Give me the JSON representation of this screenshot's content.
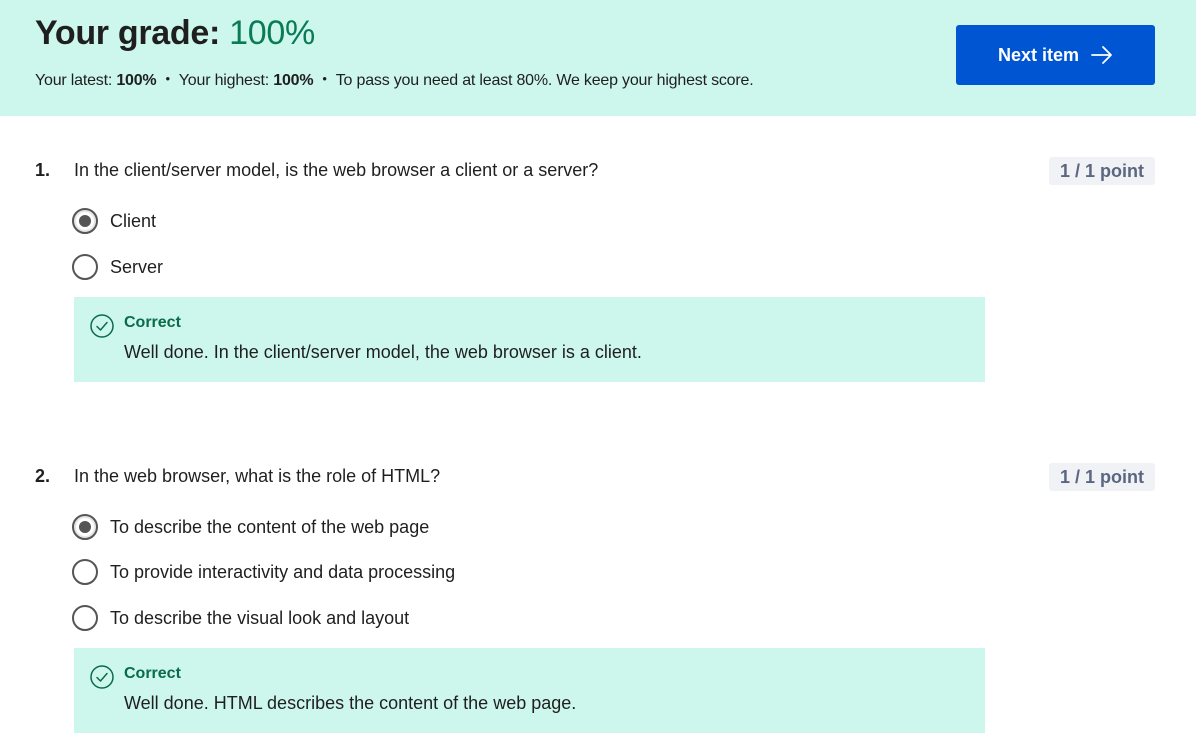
{
  "header": {
    "grade_label": "Your grade: ",
    "grade_value": "100%",
    "latest_label": "Your latest: ",
    "latest_value": "100%",
    "highest_label": "Your highest: ",
    "highest_value": "100%",
    "separator": "•",
    "pass_text": "To pass you need at least 80%. We keep your highest score.",
    "next_button_label": "Next item",
    "next_button_icon": "arrow-right-icon"
  },
  "questions": [
    {
      "number": "1.",
      "text": "In the client/server model, is the web browser a client or a server?",
      "points": "1 / 1 point",
      "options": [
        {
          "label": "Client",
          "selected": true
        },
        {
          "label": "Server",
          "selected": false
        }
      ],
      "feedback": {
        "status": "Correct",
        "icon": "check-circle-icon",
        "text": "Well done. In the client/server model, the web browser is a client."
      }
    },
    {
      "number": "2.",
      "text": "In the web browser, what is the role of HTML?",
      "points": "1 / 1 point",
      "options": [
        {
          "label": "To describe the content of the web page",
          "selected": true
        },
        {
          "label": "To provide interactivity and data processing",
          "selected": false
        },
        {
          "label": "To describe the visual look and layout",
          "selected": false
        }
      ],
      "feedback": {
        "status": "Correct",
        "icon": "check-circle-icon",
        "text": "Well done. HTML describes the content of the web page."
      }
    }
  ],
  "colors": {
    "banner_bg": "#cdf7ec",
    "grade_green": "#0a7b55",
    "primary_button": "#0056d2",
    "points_bg": "#f0f2f6",
    "feedback_bg": "#cdf7ec",
    "correct_green": "#0a6b4a"
  }
}
